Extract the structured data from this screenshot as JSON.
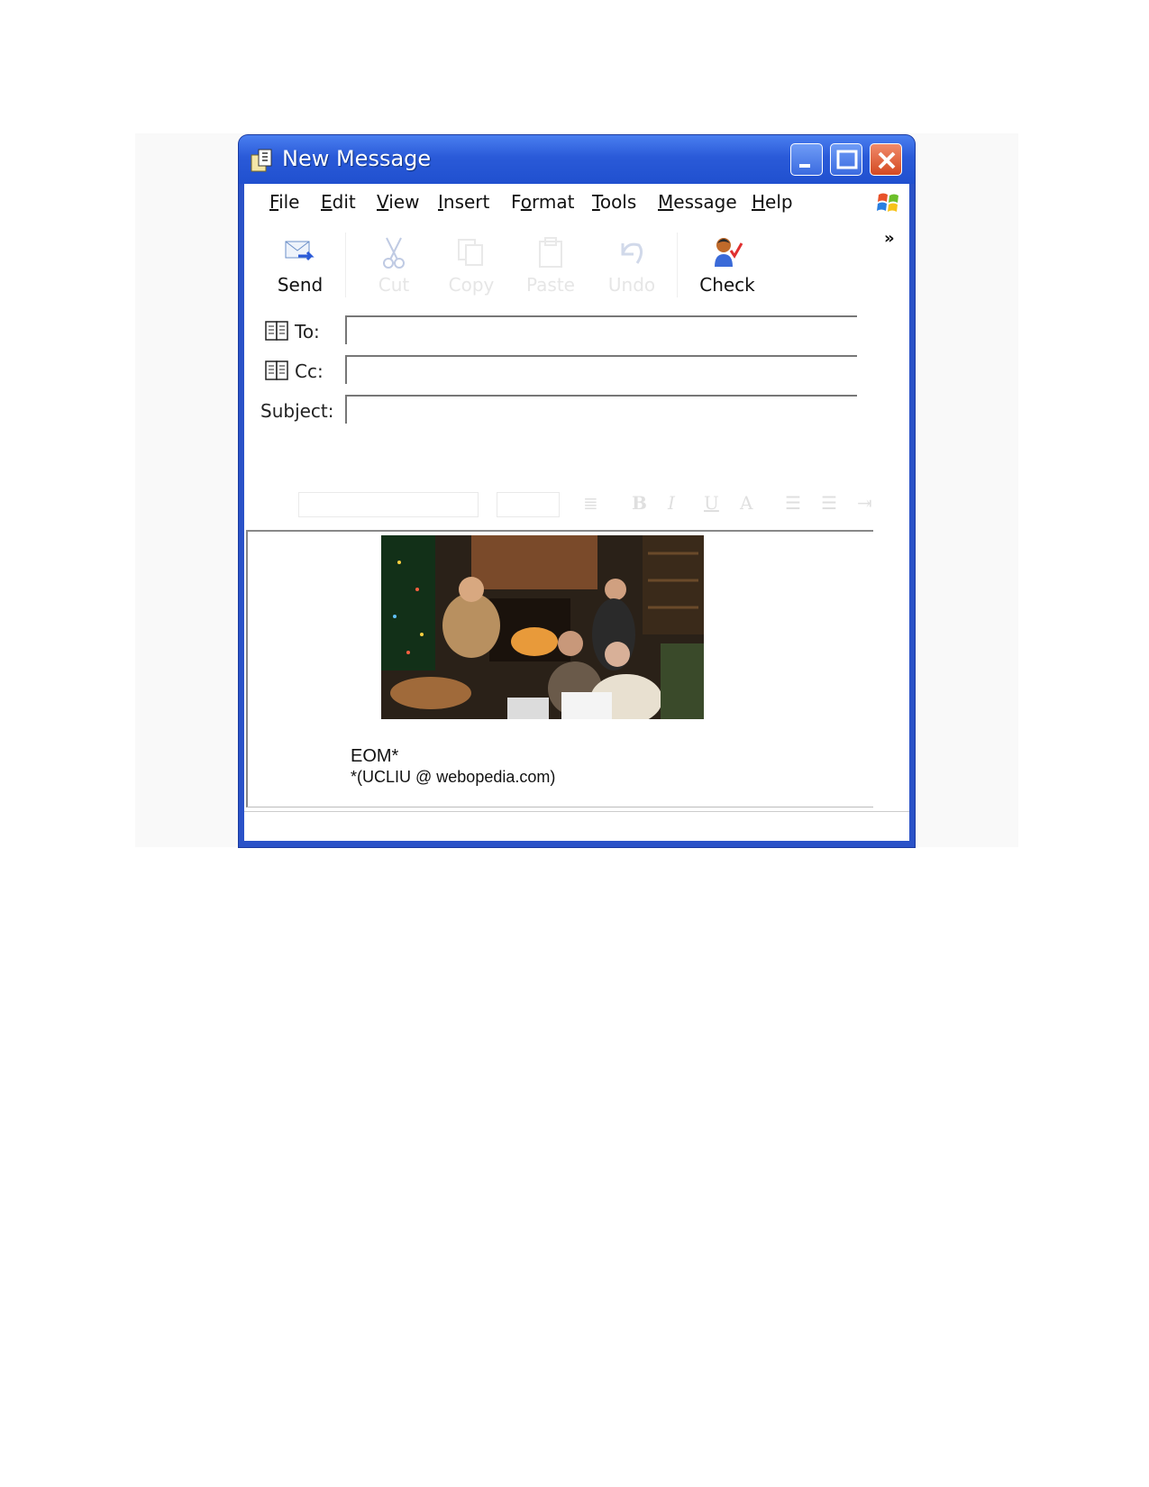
{
  "window": {
    "title": "New Message"
  },
  "menu": [
    "File",
    "Edit",
    "View",
    "Insert",
    "Format",
    "Tools",
    "Message",
    "Help"
  ],
  "menu_underline": [
    "F",
    "E",
    "V",
    "I",
    "o",
    "T",
    "M",
    "H"
  ],
  "toolbar": {
    "send": "Send",
    "cut": "Cut",
    "copy": "Copy",
    "paste": "Paste",
    "undo": "Undo",
    "check": "Check",
    "overflow": "»"
  },
  "fields": {
    "to_label": "To:",
    "cc_label": "Cc:",
    "subject_label": "Subject:",
    "to_value": "",
    "cc_value": "",
    "subject_value": ""
  },
  "body": {
    "eom": "EOM*",
    "signature": "*(UCLIU @ webopedia.com)"
  },
  "colors": {
    "titlebar": "#2a5ad8",
    "close": "#d44a22",
    "disabled_text": "#e6e6e6"
  }
}
